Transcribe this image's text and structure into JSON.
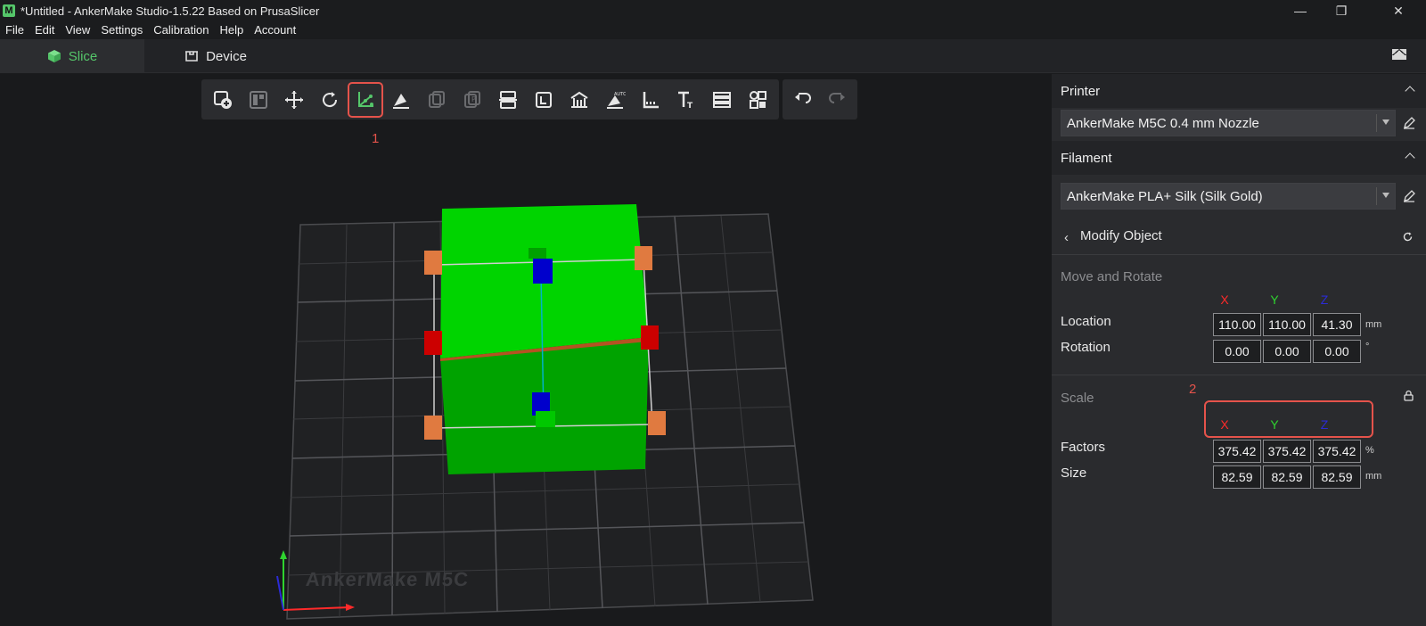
{
  "window": {
    "app_letter": "M",
    "title": "*Untitled - AnkerMake Studio-1.5.22 Based on PrusaSlicer",
    "minimize": "—",
    "maximize": "❐",
    "close": "✕"
  },
  "menu": [
    "File",
    "Edit",
    "View",
    "Settings",
    "Calibration",
    "Help",
    "Account"
  ],
  "tabs": {
    "slice": "Slice",
    "device": "Device"
  },
  "toolbar": {
    "tools": [
      "add-object-icon",
      "arrange-icon",
      "move-icon",
      "rotate-icon",
      "scale-axis-icon",
      "place-on-face-icon",
      "copy-icon",
      "paste-icon",
      "cut-icon",
      "support-icon",
      "seam-icon",
      "auto-orient-icon",
      "measure-icon",
      "text-icon",
      "layers-icon",
      "shapes-icon"
    ],
    "active_tool": "scale-axis-icon",
    "undo_redo": [
      "undo-icon",
      "redo-icon"
    ]
  },
  "annotations": {
    "one": "1",
    "two": "2"
  },
  "bed": {
    "label": "AnkerMake  M5C"
  },
  "panel": {
    "printer_header": "Printer",
    "printer_value": "AnkerMake M5C 0.4 mm Nozzle",
    "filament_header": "Filament",
    "filament_value": "AnkerMake PLA+ Silk (Silk Gold)",
    "modify_title": "Modify Object",
    "move_rotate_title": "Move and Rotate",
    "axes": {
      "x": "X",
      "y": "Y",
      "z": "Z"
    },
    "location_label": "Location",
    "location": [
      "110.00",
      "110.00",
      "41.30"
    ],
    "location_unit": "mm",
    "rotation_label": "Rotation",
    "rotation": [
      "0.00",
      "0.00",
      "0.00"
    ],
    "rotation_unit": "°",
    "scale_title": "Scale",
    "factors_label": "Factors",
    "factors": [
      "375.42",
      "375.42",
      "375.42"
    ],
    "factors_unit": "%",
    "size_label": "Size",
    "size": [
      "82.59",
      "82.59",
      "82.59"
    ],
    "size_unit": "mm"
  },
  "colors": {
    "accent_green": "#55c66a",
    "axis_x": "#ff2a2a",
    "axis_y": "#2fd32f",
    "axis_z": "#2b2bd6",
    "highlight_red": "#e5534b"
  }
}
